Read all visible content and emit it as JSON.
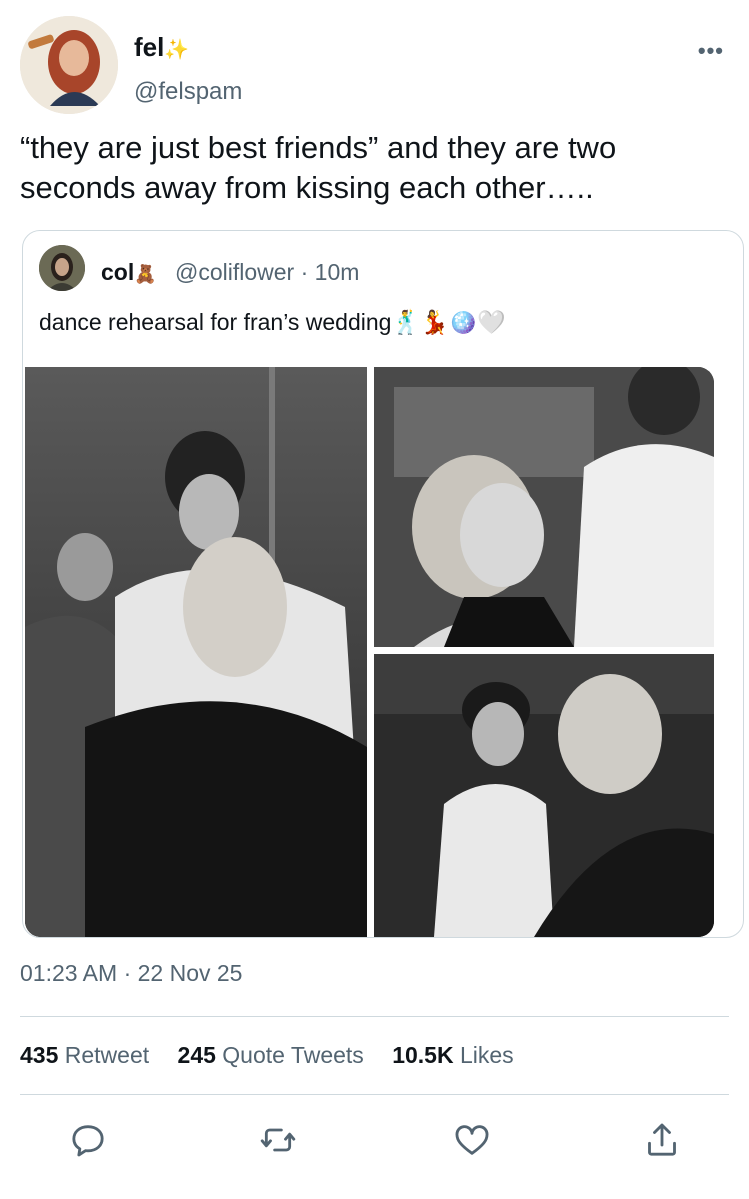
{
  "author": {
    "display_name": "fel",
    "name_emoji": "✨",
    "handle": "@felspam"
  },
  "tweet": {
    "text": "“they are just best friends” and they are two seconds away from kissing each other…..",
    "timestamp": "01:23 AM · 22 Nov 25"
  },
  "quoted": {
    "display_name": "col",
    "name_emoji": "🧸",
    "handle": "@coliflower · 10m",
    "text": "dance rehearsal for fran’s wedding🕺💃🪩🤍"
  },
  "stats": {
    "retweets_count": "435",
    "retweets_label": "Retweet",
    "quotes_count": "245",
    "quotes_label": "Quote Tweets",
    "likes_count": "10.5K",
    "likes_label": "Likes"
  },
  "more_label": "•••",
  "icons": [
    "reply-icon",
    "retweet-icon",
    "like-icon",
    "share-icon"
  ],
  "colors": {
    "secondary_text": "#536471",
    "border": "#cfd9de",
    "primary_text": "#0f1419"
  }
}
